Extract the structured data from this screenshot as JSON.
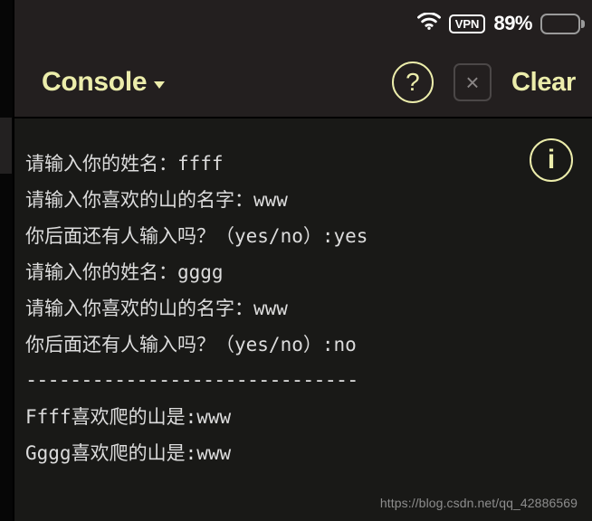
{
  "status_bar": {
    "wifi_icon": "wifi-icon",
    "vpn_label": "VPN",
    "battery_percent": "89%",
    "battery_icon": "battery-icon"
  },
  "header": {
    "title": "Console",
    "dropdown_icon": "chevron-down-icon",
    "help_icon": "?",
    "close_icon": "×",
    "clear_label": "Clear"
  },
  "console": {
    "info_icon": "i",
    "lines": [
      "请输入你的姓名：ffff",
      "请输入你喜欢的山的名字：www",
      "你后面还有人输入吗？（yes/no）:yes",
      "请输入你的姓名：gggg",
      "请输入你喜欢的山的名字：www",
      "你后面还有人输入吗？（yes/no）:no",
      "------------------------------",
      "Ffff喜欢爬的山是:www",
      "Gggg喜欢爬的山是:www"
    ]
  },
  "watermark": {
    "text": "https://blog.csdn.net/qq_42886569"
  },
  "colors": {
    "accent_yellow": "#ecedab",
    "header_bg": "#231f1f",
    "console_bg": "#191917",
    "log_text": "#dcdcdc"
  }
}
